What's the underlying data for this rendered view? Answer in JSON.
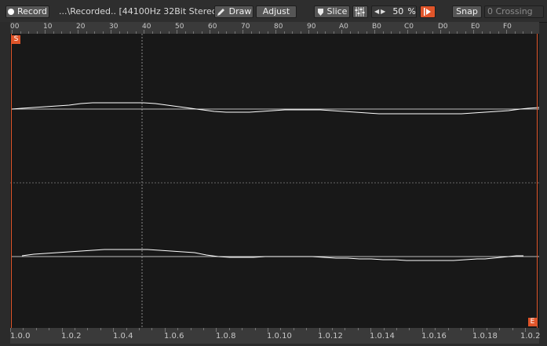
{
  "toolbar": {
    "record_label": "Record",
    "file_info": "...\\Recorded.. [44100Hz 32Bit Stereo]",
    "draw_label": "Draw",
    "adjust_label": "Adjust",
    "slice_label": "Slice",
    "zoom_value": "50",
    "zoom_unit": "%",
    "snap_label": "Snap",
    "snap_mode": "0 Crossing"
  },
  "ruler": {
    "labels": [
      "00",
      "10",
      "20",
      "30",
      "40",
      "50",
      "60",
      "70",
      "80",
      "90",
      "A0",
      "B0",
      "C0",
      "D0",
      "E0",
      "F0"
    ]
  },
  "markers": {
    "start": "S",
    "end": "E"
  },
  "timeline": {
    "labels": [
      "1.0.0",
      "1.0.2",
      "1.0.4",
      "1.0.6",
      "1.0.8",
      "1.0.10",
      "1.0.12",
      "1.0.14",
      "1.0.16",
      "1.0.18",
      "1.0.2"
    ]
  },
  "colors": {
    "accent": "#e0552a",
    "background": "#181818",
    "waveform": "#ffffff",
    "grid": "#777777"
  }
}
